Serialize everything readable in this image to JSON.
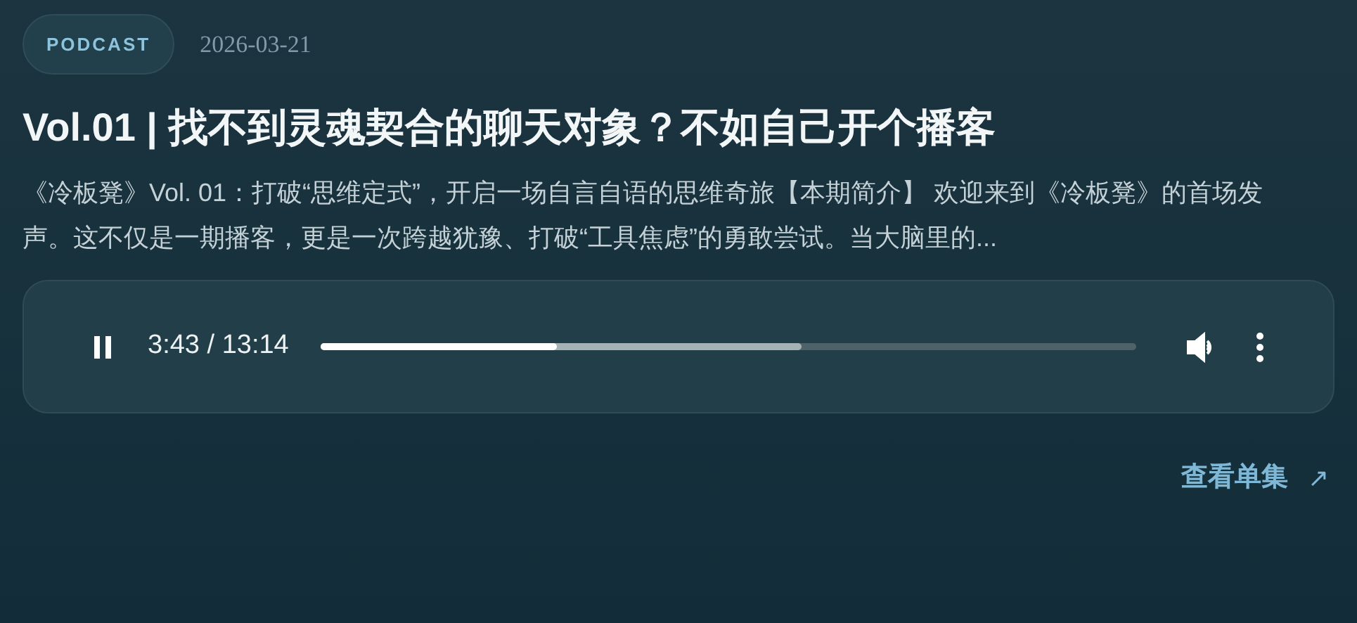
{
  "tag": "PODCAST",
  "date": "2026-03-21",
  "title": "Vol.01 | 找不到灵魂契合的聊天对象？不如自己开个播客",
  "summary": "《冷板凳》Vol. 01：打破“思维定式”，开启一场自言自语的思维奇旅【本期简介】 欢迎来到《冷板凳》的首场发声。这不仅是一期播客，更是一次跨越犹豫、打破“工具焦虑”的勇敢尝试。当大脑里的...",
  "player": {
    "playing": true,
    "time": "3:43 / 13:14",
    "progress": {
      "level": 0.29
    },
    "buffered": {
      "level": 0.59
    }
  },
  "link": {
    "label": "查看单集",
    "arrow": "↗"
  }
}
